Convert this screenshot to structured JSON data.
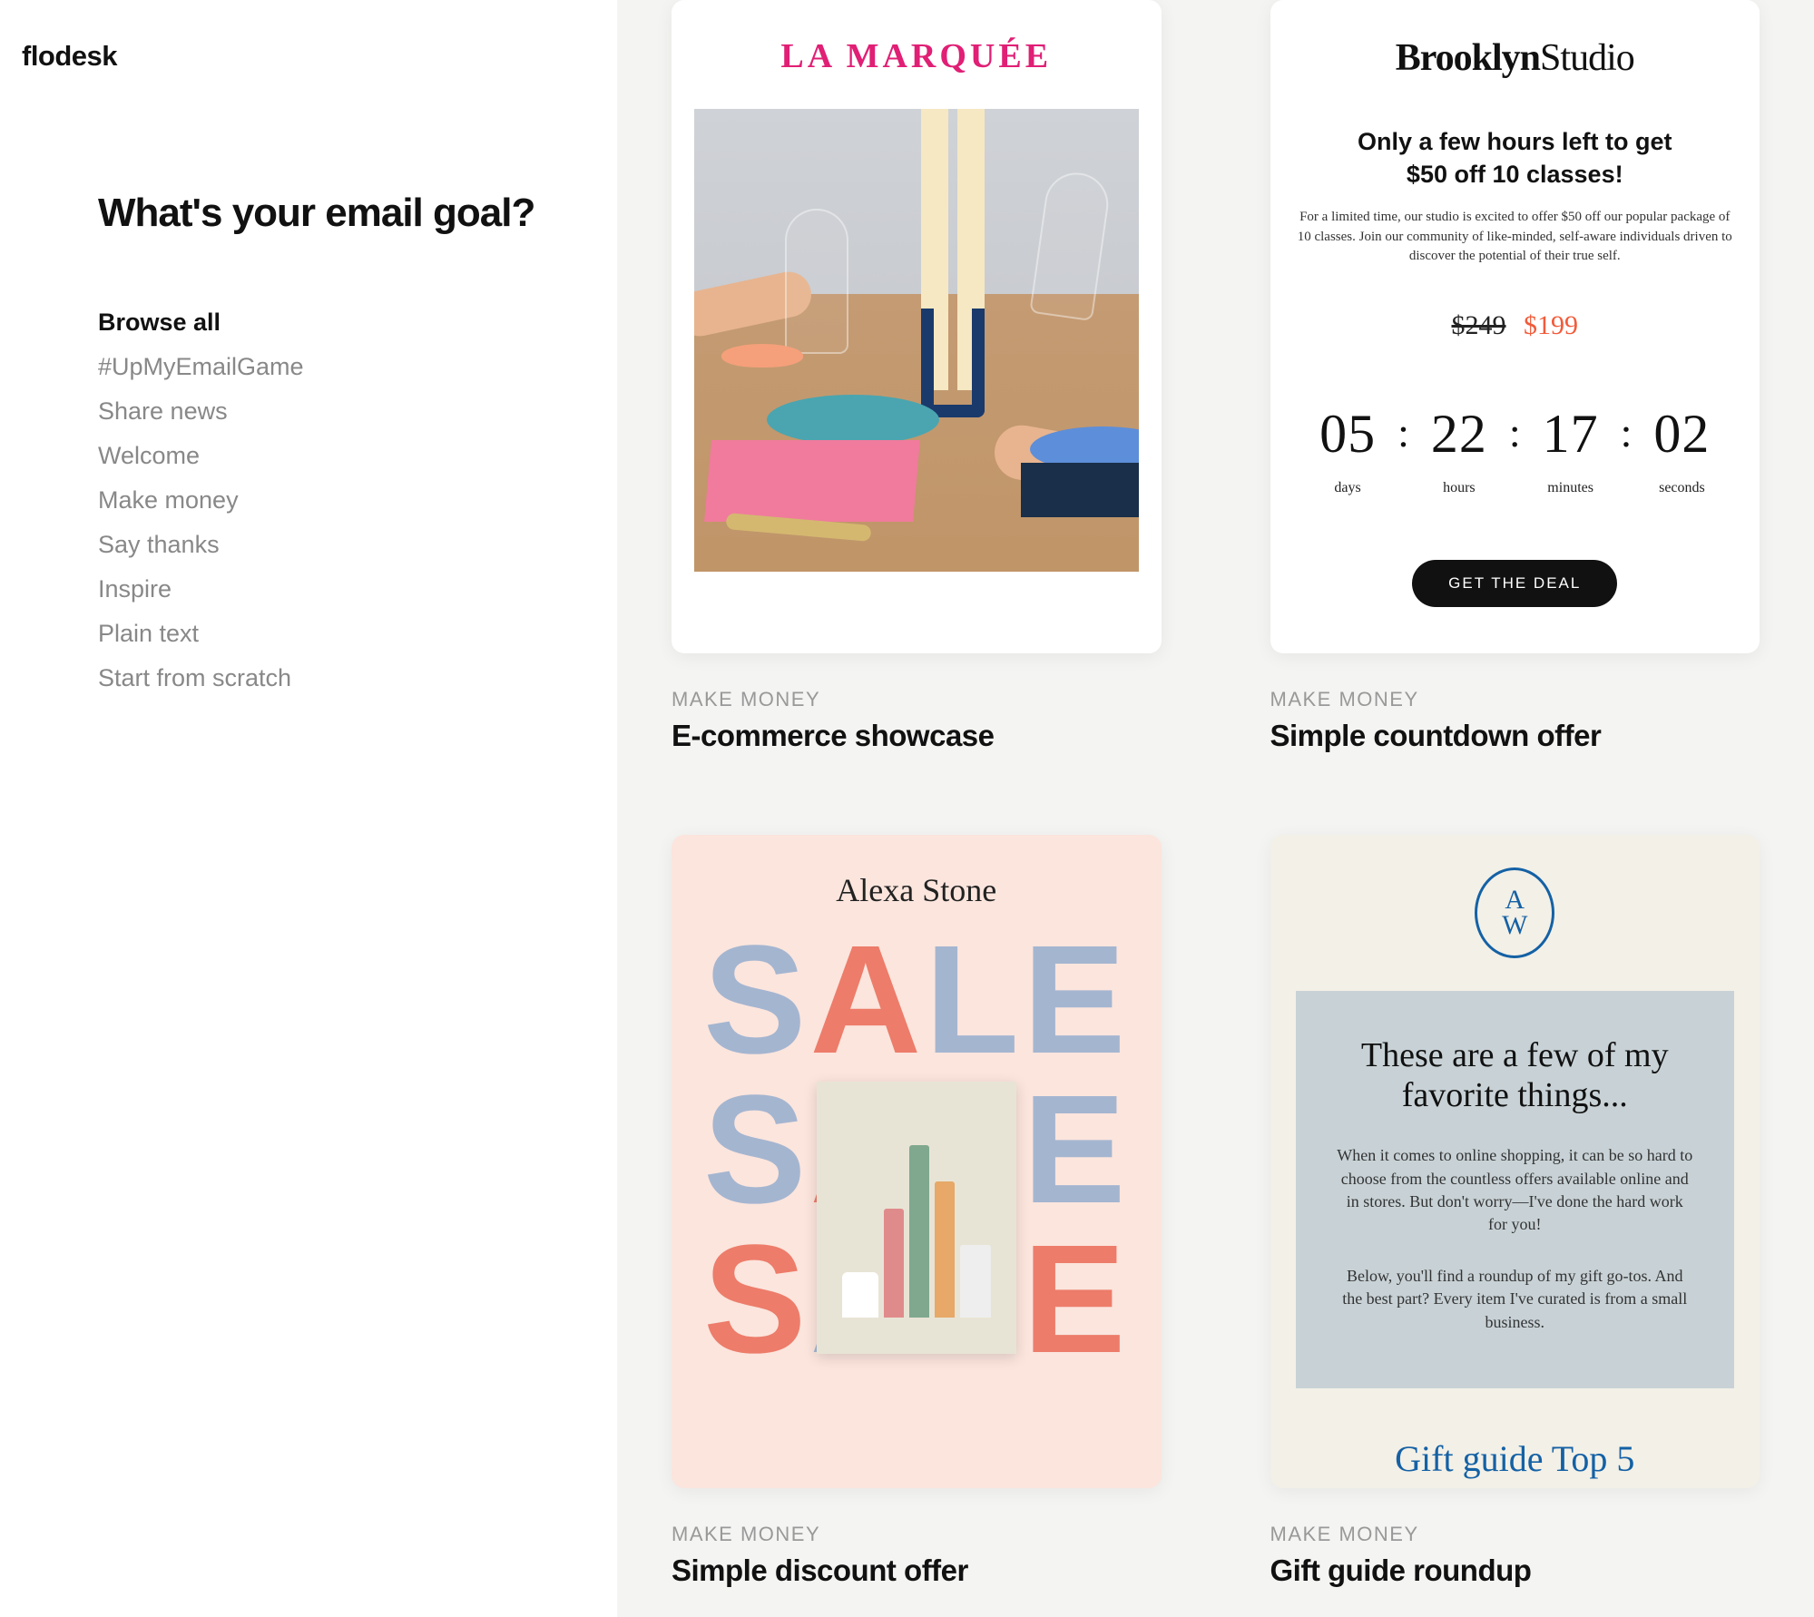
{
  "logo": "flodesk",
  "sidebar": {
    "title": "What's your email goal?",
    "items": [
      "Browse all",
      "#UpMyEmailGame",
      "Share news",
      "Welcome",
      "Make money",
      "Say thanks",
      "Inspire",
      "Plain text",
      "Start from scratch"
    ],
    "active_index": 0
  },
  "templates": [
    {
      "category": "MAKE MONEY",
      "title": "E-commerce showcase",
      "preview": {
        "brand": "LA MARQUÉE"
      }
    },
    {
      "category": "MAKE MONEY",
      "title": "Simple countdown offer",
      "preview": {
        "brand_bold": "Brooklyn",
        "brand_light": "Studio",
        "headline1": "Only a few hours left to get",
        "headline2": "$50 off 10 classes!",
        "description": "For a limited time, our studio is excited to offer $50 off our popular package of 10 classes. Join our community of like-minded, self-aware individuals driven to discover the potential of their true self.",
        "old_price": "$249",
        "new_price": "$199",
        "countdown": {
          "days": {
            "value": "05",
            "label": "days"
          },
          "hours": {
            "value": "22",
            "label": "hours"
          },
          "minutes": {
            "value": "17",
            "label": "minutes"
          },
          "seconds": {
            "value": "02",
            "label": "seconds"
          }
        },
        "cta": "GET THE DEAL"
      }
    },
    {
      "category": "MAKE MONEY",
      "title": "Simple discount offer",
      "preview": {
        "brand": "Alexa Stone",
        "word": "SALE"
      }
    },
    {
      "category": "MAKE MONEY",
      "title": "Gift guide roundup",
      "preview": {
        "monogram1": "A",
        "monogram2": "W",
        "headline": "These are a few of my favorite things...",
        "p1": "When it comes to online shopping, it can be so hard to choose from the countless offers available online and in stores. But don't worry—I've done the hard work for you!",
        "p2": "Below, you'll find a roundup of my gift go-tos. And the best part? Every item I've curated is from a small business.",
        "footer": "Gift guide Top 5"
      }
    }
  ]
}
